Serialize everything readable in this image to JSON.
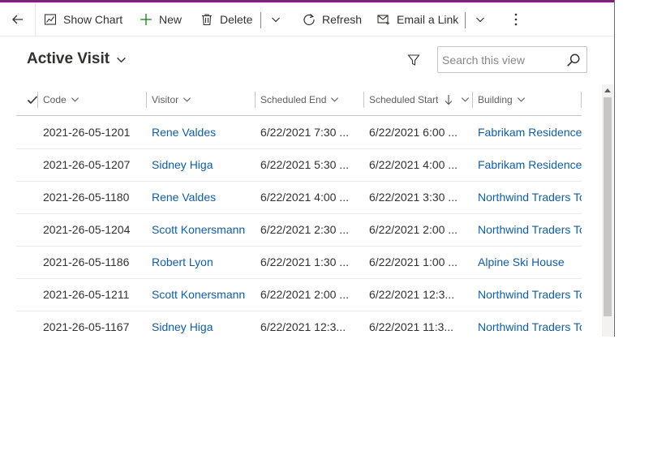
{
  "commandbar": {
    "show_chart": "Show Chart",
    "new": "New",
    "delete": "Delete",
    "refresh": "Refresh",
    "email_link": "Email a Link"
  },
  "view": {
    "title": "Active Visit",
    "search_placeholder": "Search this view"
  },
  "grid": {
    "columns": [
      "Code",
      "Visitor",
      "Scheduled End",
      "Scheduled Start",
      "Building"
    ],
    "sorted_column": "Scheduled Start",
    "sort_direction": "descending",
    "rows": [
      {
        "code": "2021-26-05-1201",
        "visitor": "Rene Valdes",
        "end": "6/22/2021 7:30 ...",
        "start": "6/22/2021 6:00 ...",
        "building": "Fabrikam Residences"
      },
      {
        "code": "2021-26-05-1207",
        "visitor": "Sidney Higa",
        "end": "6/22/2021 5:30 ...",
        "start": "6/22/2021 4:00 ...",
        "building": "Fabrikam Residences"
      },
      {
        "code": "2021-26-05-1180",
        "visitor": "Rene Valdes",
        "end": "6/22/2021 4:00 ...",
        "start": "6/22/2021 3:30 ...",
        "building": "Northwind Traders To"
      },
      {
        "code": "2021-26-05-1204",
        "visitor": "Scott Konersmann",
        "end": "6/22/2021 2:30 ...",
        "start": "6/22/2021 2:00 ...",
        "building": "Northwind Traders To"
      },
      {
        "code": "2021-26-05-1186",
        "visitor": "Robert Lyon",
        "end": "6/22/2021 1:30 ...",
        "start": "6/22/2021 1:00 ...",
        "building": "Alpine Ski House"
      },
      {
        "code": "2021-26-05-1211",
        "visitor": "Scott Konersmann",
        "end": "6/22/2021 2:00 ...",
        "start": "6/22/2021 12:3...",
        "building": "Northwind Traders To"
      },
      {
        "code": "2021-26-05-1167",
        "visitor": "Sidney Higa",
        "end": "6/22/2021 12:3...",
        "start": "6/22/2021 11:3...",
        "building": "Northwind Traders To"
      }
    ]
  },
  "colors": {
    "accent_bar": "#742774",
    "link": "#115ea3",
    "text": "#323130",
    "header_text": "#605e5c"
  },
  "icons": [
    "back-arrow-icon",
    "chart-icon",
    "plus-icon",
    "trash-icon",
    "chevron-down-icon",
    "refresh-icon",
    "email-link-icon",
    "more-vertical-icon",
    "filter-icon",
    "search-icon",
    "checkmark-icon",
    "sort-down-arrow-icon"
  ]
}
